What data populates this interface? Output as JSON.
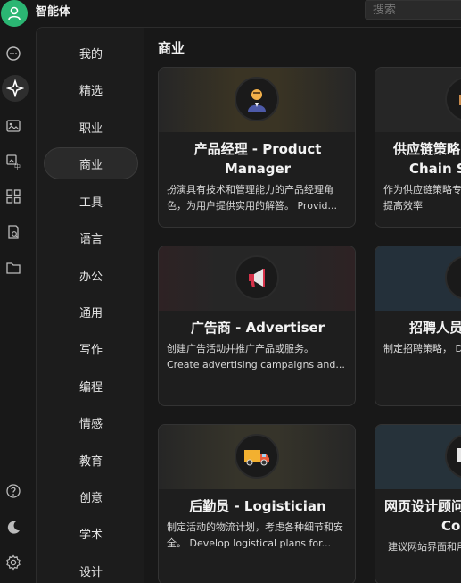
{
  "header": {
    "app_title": "智能体",
    "search_placeholder": "搜索"
  },
  "rail": {
    "icons": [
      "chat-icon",
      "sparkle-icon",
      "image-icon",
      "image-translate-icon",
      "apps-grid-icon",
      "doc-search-icon",
      "folder-icon",
      "help-icon",
      "moon-icon",
      "settings-icon"
    ]
  },
  "categories": [
    "我的",
    "精选",
    "职业",
    "商业",
    "工具",
    "语言",
    "办公",
    "通用",
    "写作",
    "编程",
    "情感",
    "教育",
    "创意",
    "学术",
    "设计"
  ],
  "active_category": "商业",
  "section_title": "商业",
  "cards": [
    {
      "title_line1": "产品经理 - Product",
      "title_line2": "Manager",
      "desc": "扮演具有技术和管理能力的产品经理角色，为用户提供实用的解答。 Provid...",
      "icon": "product-manager-icon",
      "banner_color": "#3a3424"
    },
    {
      "title_line1": "供应链策略",
      "title_line2": "Chain Str",
      "desc": "作为供应链策略专家，优化供应链流程，提高效率",
      "icon": "supply-chain-icon",
      "banner_color": "#2a2a2a"
    },
    {
      "title_line1": "广告商 - Advertiser",
      "title_line2": "",
      "desc": "创建广告活动并推广产品或服务。 Create advertising campaigns and...",
      "icon": "megaphone-icon",
      "banner_color": "#3a2428"
    },
    {
      "title_line1": "招聘人员",
      "title_line2": "",
      "desc": "制定招聘策略， Develop recruitment",
      "icon": "recruiter-icon",
      "banner_color": "#24303a"
    },
    {
      "title_line1": "后勤员 - Logistician",
      "title_line2": "",
      "desc": "制定活动的物流计划，考虑各种细节和安全。 Develop logistical plans for...",
      "icon": "truck-icon",
      "banner_color": "#36342a"
    },
    {
      "title_line1": "网页设计顾问",
      "title_line2": "Con",
      "desc": "建议网站界面和用户体验。 Suggest w",
      "icon": "web-design-icon",
      "banner_color": "#26323a"
    }
  ]
}
